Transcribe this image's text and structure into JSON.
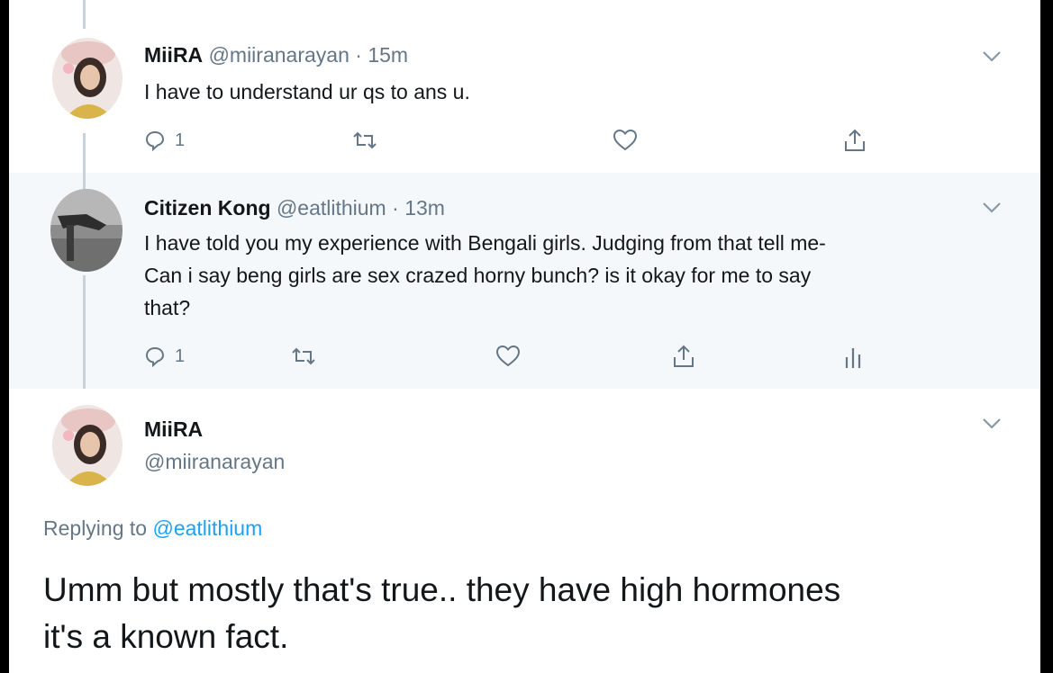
{
  "tweets": [
    {
      "name": "MiiRA",
      "handle": "@miiranarayan",
      "separator": "·",
      "time": "15m",
      "text_lines": [
        "I have to understand ur qs to ans u."
      ],
      "reply_count": "1",
      "icons": [
        "reply-icon",
        "retweet-icon",
        "like-icon",
        "share-icon"
      ]
    },
    {
      "name": "Citizen Kong",
      "handle": "@eatlithium",
      "separator": "·",
      "time": "13m",
      "text_lines": [
        "I have told you my experience with Bengali girls. Judging from that tell me-",
        "Can i say beng girls are sex crazed horny bunch? is it okay for me to say",
        "that?"
      ],
      "reply_count": "1",
      "icons": [
        "reply-icon",
        "retweet-icon",
        "like-icon",
        "share-icon",
        "analytics-icon"
      ]
    }
  ],
  "main_tweet": {
    "name": "MiiRA",
    "handle": "@miiranarayan",
    "replying_prefix": "Replying to",
    "replying_to": "@eatlithium",
    "text_lines": [
      "Umm but mostly that's true.. they have high hormones",
      "it's a known fact."
    ]
  },
  "colors": {
    "secondary_text": "#657786",
    "link": "#1da1f2",
    "thread_line": "#c9d2d9",
    "highlight_background": "#f5f8fa"
  }
}
